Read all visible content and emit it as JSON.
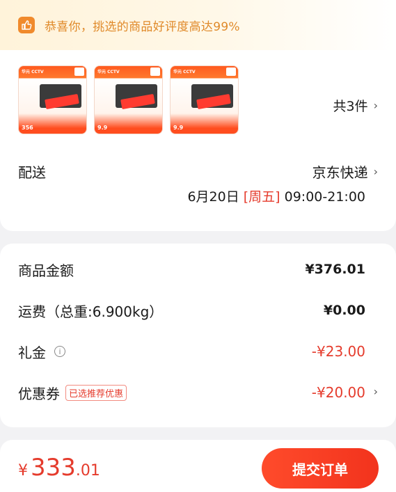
{
  "banner": {
    "text": "恭喜你，挑选的商品好评度高达99%",
    "icon": "thumbs-up-icon"
  },
  "products": {
    "thumbs": [
      {
        "brand": "华元 CCTV",
        "price": "356"
      },
      {
        "brand": "华元 CCTV",
        "price": "9.9"
      },
      {
        "brand": "华元 CCTV",
        "price": "9.9"
      }
    ],
    "count_label": "共3件"
  },
  "shipping": {
    "label": "配送",
    "carrier": "京东快递",
    "date": "6月20日",
    "weekday": "[周五]",
    "time": "09:00-21:00"
  },
  "fees": {
    "goods_label": "商品金额",
    "goods_value": "¥376.01",
    "freight_label": "运费（总重:6.900kg）",
    "freight_value": "¥0.00",
    "gift_label": "礼金",
    "gift_value": "-¥23.00",
    "coupon_label": "优惠券",
    "coupon_tag": "已选推荐优惠",
    "coupon_value": "-¥20.00"
  },
  "total": {
    "currency": "¥",
    "integer": "333",
    "decimal": ".01"
  },
  "submit_label": "提交订单",
  "colors": {
    "accent": "#e53b2c",
    "banner_text": "#e08a2a"
  }
}
